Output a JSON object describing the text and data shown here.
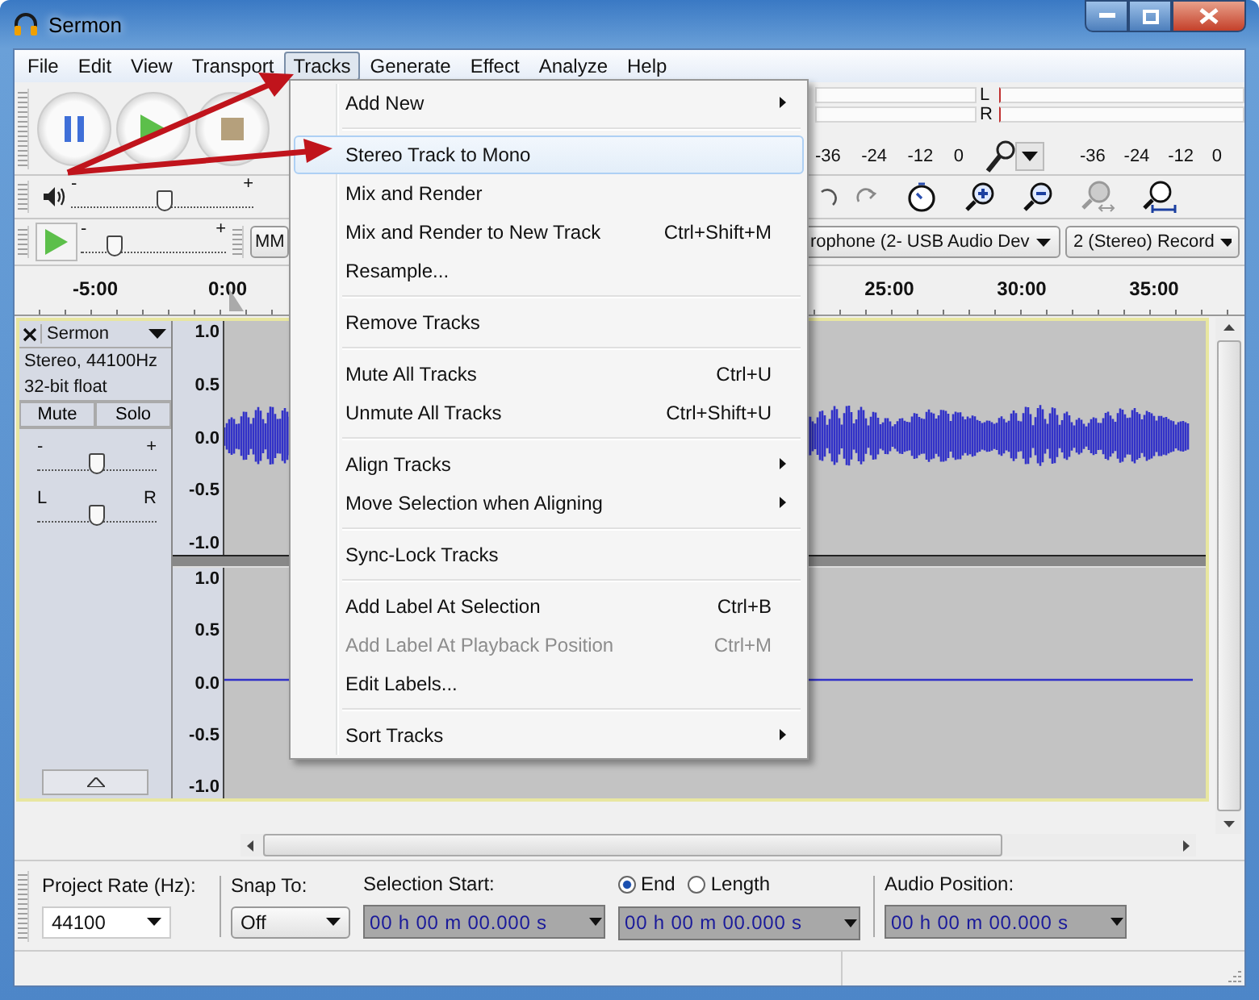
{
  "window": {
    "title": "Sermon"
  },
  "menu_bar": [
    {
      "label": "File",
      "selected": false
    },
    {
      "label": "Edit",
      "selected": false
    },
    {
      "label": "View",
      "selected": false
    },
    {
      "label": "Transport",
      "selected": false
    },
    {
      "label": "Tracks",
      "selected": true
    },
    {
      "label": "Generate",
      "selected": false
    },
    {
      "label": "Effect",
      "selected": false
    },
    {
      "label": "Analyze",
      "selected": false
    },
    {
      "label": "Help",
      "selected": false
    }
  ],
  "tracks_menu": {
    "groups": [
      [
        {
          "label": "Add New",
          "submenu": true,
          "selected": false,
          "disabled": false
        }
      ],
      [
        {
          "label": "Stereo Track to Mono",
          "submenu": false,
          "selected": true,
          "disabled": false
        },
        {
          "label": "Mix and Render",
          "submenu": false,
          "selected": false,
          "disabled": false
        },
        {
          "label": "Mix and Render to New Track",
          "shortcut": "Ctrl+Shift+M",
          "submenu": false,
          "selected": false,
          "disabled": false
        },
        {
          "label": "Resample...",
          "submenu": false,
          "selected": false,
          "disabled": false
        }
      ],
      [
        {
          "label": "Remove Tracks",
          "submenu": false,
          "selected": false,
          "disabled": false
        }
      ],
      [
        {
          "label": "Mute All Tracks",
          "shortcut": "Ctrl+U",
          "submenu": false,
          "selected": false,
          "disabled": false
        },
        {
          "label": "Unmute All Tracks",
          "shortcut": "Ctrl+Shift+U",
          "submenu": false,
          "selected": false,
          "disabled": false
        }
      ],
      [
        {
          "label": "Align Tracks",
          "submenu": true,
          "selected": false,
          "disabled": false
        },
        {
          "label": "Move Selection when Aligning",
          "submenu": true,
          "selected": false,
          "disabled": false
        }
      ],
      [
        {
          "label": "Sync-Lock Tracks",
          "submenu": false,
          "selected": false,
          "disabled": false
        }
      ],
      [
        {
          "label": "Add Label At Selection",
          "shortcut": "Ctrl+B",
          "submenu": false,
          "selected": false,
          "disabled": false
        },
        {
          "label": "Add Label At Playback Position",
          "shortcut": "Ctrl+M",
          "submenu": false,
          "selected": false,
          "disabled": true
        },
        {
          "label": "Edit Labels...",
          "submenu": false,
          "selected": false,
          "disabled": false
        }
      ],
      [
        {
          "label": "Sort Tracks",
          "submenu": true,
          "selected": false,
          "disabled": false
        }
      ]
    ]
  },
  "meter_toolbar": {
    "play_ticks": [
      "-36",
      "-24",
      "-12",
      "0"
    ],
    "record_channels": [
      "L",
      "R"
    ],
    "record_ticks": [
      "-36",
      "-24",
      "-12",
      "0"
    ]
  },
  "mixer_toolbar": {
    "minus": "-",
    "plus": "+",
    "level": 0.51
  },
  "play_at_speed": {
    "minus": "-",
    "plus": "+",
    "level": 0.23
  },
  "device_toolbar": {
    "host": "MM",
    "input": "rophone (2- USB Audio Dev",
    "channels": "2 (Stereo) Record"
  },
  "ruler": {
    "labels": [
      "-5:00",
      "0:00",
      "25:00",
      "30:00",
      "35:00"
    ]
  },
  "track": {
    "name": "Sermon",
    "info": [
      "Stereo, 44100Hz",
      "32-bit float"
    ],
    "mute": "Mute",
    "solo": "Solo",
    "gain": {
      "minus": "-",
      "plus": "+",
      "level": 0.5
    },
    "pan": {
      "left": "L",
      "right": "R",
      "level": 0.5
    },
    "channels": [
      {
        "kind": "wave",
        "scale": [
          "1.0",
          "0.5",
          "0.0",
          "-0.5",
          "-1.0"
        ]
      },
      {
        "kind": "flat",
        "scale": [
          "1.0",
          "0.5",
          "0.0",
          "-0.5",
          "-1.0"
        ]
      }
    ]
  },
  "selection_bar": {
    "project_rate": {
      "label": "Project Rate (Hz):",
      "value": "44100"
    },
    "snap_to": {
      "label": "Snap To:",
      "value": "Off"
    },
    "selection_start": {
      "label": "Selection Start:",
      "time": "00 h 00 m 00.000 s"
    },
    "end_mode": [
      {
        "label": "End",
        "selected": true
      },
      {
        "label": "Length",
        "selected": false
      }
    ],
    "selection_end": {
      "time": "00 h 00 m 00.000 s"
    },
    "audio_position": {
      "label": "Audio Position:",
      "time": "00 h 00 m 00.000 s"
    }
  }
}
